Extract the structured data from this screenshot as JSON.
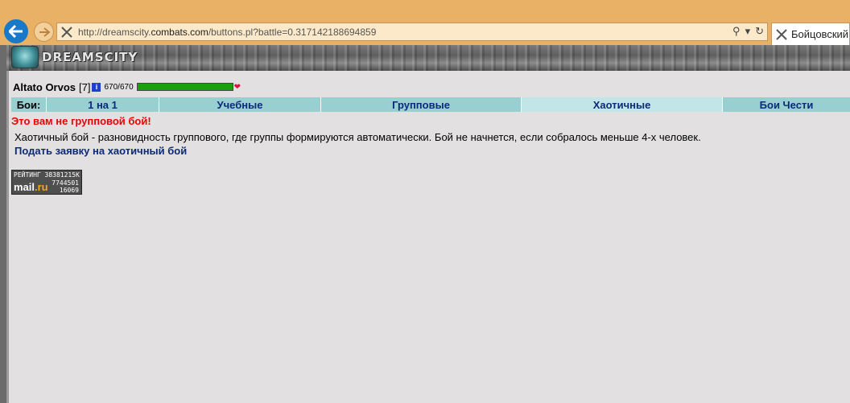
{
  "browser": {
    "url_prefix": "http://dreamscity.",
    "url_domain": "combats.com",
    "url_rest": "/buttons.pl?battle=0.317142188694859",
    "tab_title": "Бойцовский клуб"
  },
  "header": {
    "logo_text": "DREAMSCITY"
  },
  "player": {
    "name": "Altato Orvos",
    "level": "[7]",
    "info_glyph": "i",
    "hp_text": "670/670",
    "hp_fraction": 1.0
  },
  "tabs": {
    "label": "Бои:",
    "items": [
      {
        "label": "1 на 1",
        "active": false
      },
      {
        "label": "Учебные",
        "active": false
      },
      {
        "label": "Групповые",
        "active": false
      },
      {
        "label": "Хаотичные",
        "active": true
      },
      {
        "label": "Бои Чести",
        "active": false
      }
    ]
  },
  "main": {
    "warning": "Это вам не групповой бой!",
    "description": "Хаотичный бой - разновидность группового, где группы формируются автоматически. Бой не начнется, если собралось меньше 4-х человек.",
    "apply_link": "Подать заявку на хаотичный бой"
  },
  "counter": {
    "line1": "РЕЙТИНГ 38381215К",
    "brand_a": "mail",
    "brand_b": ".ru",
    "n2": "7744501",
    "n3": "16069"
  },
  "colors": {
    "warning": "#ee0000",
    "link": "#0b2a77",
    "tab_bg": "#98cfd1",
    "tab_active_bg": "#c2e6e8",
    "hp_bar": "#1aa00f"
  }
}
